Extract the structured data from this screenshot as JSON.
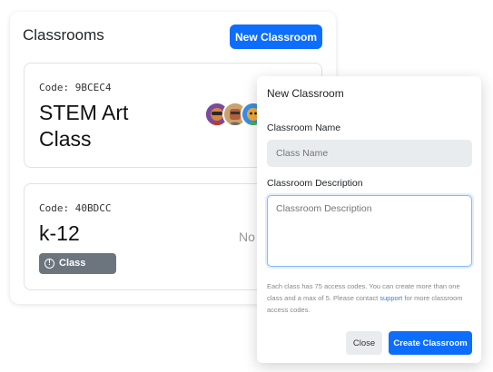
{
  "panel": {
    "title": "Classrooms",
    "new_button": "New Classroom"
  },
  "classrooms": [
    {
      "code": "Code: 9BCEC4",
      "title": "STEM Art Class",
      "avatars": [
        "student-avatar-purple",
        "student-avatar-tan",
        "student-avatar-blue"
      ]
    },
    {
      "code": "Code: 40BDCC",
      "title": "k-12",
      "status_text": "No",
      "badge": "Class Ended",
      "badge_icon": "info-circle-icon"
    }
  ],
  "modal": {
    "title": "New Classroom",
    "name_label": "Classroom Name",
    "name_placeholder": "Class Name",
    "name_value": "",
    "desc_label": "Classroom Description",
    "desc_placeholder": "Classroom Description",
    "desc_value": "",
    "help_before": "Each class has 75 access codes. You can create more than one class and a max of 5. Please contact ",
    "help_link": "support",
    "help_after": " for more classroom access codes.",
    "close_label": "Close",
    "create_label": "Create Classroom"
  },
  "colors": {
    "primary": "#0d6efd",
    "badge_gray": "#6c757d",
    "input_bg": "#e9ecef",
    "link": "#3d7dd8"
  }
}
